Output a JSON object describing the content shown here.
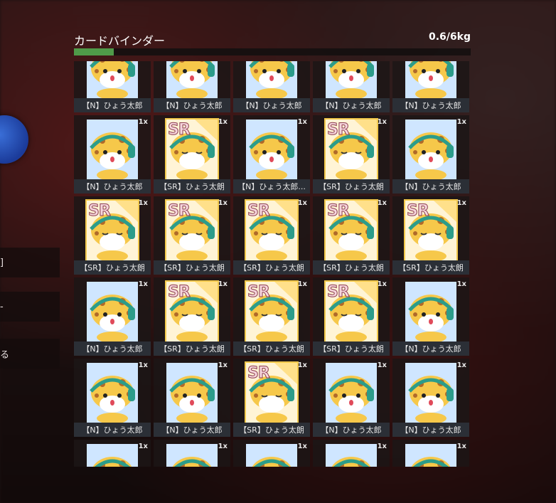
{
  "panel": {
    "title": "カードバインダー",
    "weight": "0.6/6kg",
    "progress_fraction": 0.1
  },
  "sidebar": {
    "items": [
      {
        "label": "]"
      },
      {
        "label": "-"
      },
      {
        "label": "る"
      }
    ]
  },
  "count_label": "1x",
  "cards": [
    {
      "rarity": "N",
      "label": "【N】ひょう太郎"
    },
    {
      "rarity": "N",
      "label": "【N】ひょう太郎"
    },
    {
      "rarity": "N",
      "label": "【N】ひょう太郎"
    },
    {
      "rarity": "N",
      "label": "【N】ひょう太郎"
    },
    {
      "rarity": "N",
      "label": "【N】ひょう太郎"
    },
    {
      "rarity": "N",
      "label": "【N】ひょう太郎"
    },
    {
      "rarity": "SR",
      "label": "【SR】ひょう太朗"
    },
    {
      "rarity": "N",
      "label": "【N】ひょう太郎..."
    },
    {
      "rarity": "SR",
      "label": "【SR】ひょう太朗"
    },
    {
      "rarity": "N",
      "label": "【N】ひょう太郎"
    },
    {
      "rarity": "SR",
      "label": "【SR】ひょう太朗"
    },
    {
      "rarity": "SR",
      "label": "【SR】ひょう太朗"
    },
    {
      "rarity": "SR",
      "label": "【SR】ひょう太朗"
    },
    {
      "rarity": "SR",
      "label": "【SR】ひょう太朗"
    },
    {
      "rarity": "SR",
      "label": "【SR】ひょう太朗"
    },
    {
      "rarity": "N",
      "label": "【N】ひょう太郎"
    },
    {
      "rarity": "SR",
      "label": "【SR】ひょう太朗"
    },
    {
      "rarity": "SR",
      "label": "【SR】ひょう太朗"
    },
    {
      "rarity": "SR",
      "label": "【SR】ひょう太朗"
    },
    {
      "rarity": "N",
      "label": "【N】ひょう太郎"
    },
    {
      "rarity": "N",
      "label": "【N】ひょう太郎"
    },
    {
      "rarity": "N",
      "label": "【N】ひょう太郎"
    },
    {
      "rarity": "SR",
      "label": "【SR】ひょう太朗"
    },
    {
      "rarity": "N",
      "label": "【N】ひょう太郎"
    },
    {
      "rarity": "N",
      "label": "【N】ひょう太郎"
    },
    {
      "rarity": "N",
      "label": ""
    },
    {
      "rarity": "N",
      "label": ""
    },
    {
      "rarity": "N",
      "label": ""
    },
    {
      "rarity": "N",
      "label": ""
    },
    {
      "rarity": "N",
      "label": ""
    }
  ]
}
